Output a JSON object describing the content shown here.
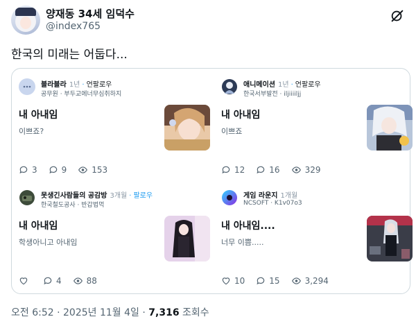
{
  "author": {
    "name": "양재동 34세 임덕수",
    "handle": "@index765"
  },
  "tweet": {
    "text": "한국의 미래는 어둡다...",
    "time": "오전 6:52",
    "date": "2025년 11월 4일",
    "views": "7,316",
    "views_label": "조회수",
    "separator": "·"
  },
  "cards": [
    {
      "source": "블라블라",
      "age": "1년",
      "follow": "언팔로우",
      "sub": "공무원 · 부두교에너무심취하지",
      "title": "내 아내임",
      "body": "이쁘죠?",
      "comments": "3",
      "retweets": "9",
      "views": "153",
      "colors": {
        "icon": "#c9d6ee",
        "thumb": "#e9c9a8"
      }
    },
    {
      "source": "애니메이션",
      "age": "1년",
      "follow": "언팔로우",
      "sub": "한국서부발전 · iljiiiiljj",
      "title": "내 아내임",
      "body": "이쁘죠",
      "comments": "12",
      "retweets": "16",
      "views": "329",
      "colors": {
        "icon": "#2c3a55",
        "thumb": "#b8c6da"
      }
    },
    {
      "source": "못생긴사람들의 공감방",
      "age": "3개월",
      "follow": "팔로우",
      "sub": "한국철도공사 · 반갑법먹",
      "title": "내 아내임",
      "body": "학생아니고 아내임",
      "comments": "",
      "retweets": "4",
      "views": "88",
      "colors": {
        "icon": "#3d4b3a",
        "thumb": "#e5d2ea"
      }
    },
    {
      "source": "게임 라운지",
      "age": "1개월",
      "follow": "",
      "sub": "NCSOFT · K1v07o3",
      "title": "내 아내임....",
      "body": "너무 이쁨.....",
      "comments": "10",
      "retweets": "15",
      "views": "3,294",
      "colors": {
        "icon": "#7a3fd1",
        "thumb": "#3a3d48"
      }
    }
  ]
}
